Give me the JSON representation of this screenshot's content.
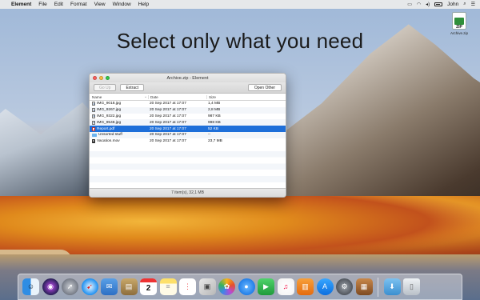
{
  "menubar": {
    "app_name": "Element",
    "items": [
      "File",
      "Edit",
      "Format",
      "View",
      "Window",
      "Help"
    ],
    "user": "John"
  },
  "headline": "Select only what you need",
  "desktop_icon": {
    "label": "ZIP",
    "caption": "Archive.zip"
  },
  "window": {
    "title": "Archive.zip - Element",
    "toolbar": {
      "go_up": "Go Up",
      "extract": "Extract",
      "open_other": "Open Other"
    },
    "columns": {
      "name": "Name",
      "date": "Date",
      "size": "Size"
    },
    "rows": [
      {
        "icon": "image-icon",
        "name": "IMG_9018.jpg",
        "date": "20 Sep 2017 at 17:07",
        "size": "1,4 MB",
        "selected": false
      },
      {
        "icon": "image-icon",
        "name": "IMG_9267.jpg",
        "date": "20 Sep 2017 at 17:07",
        "size": "2,8 MB",
        "selected": false
      },
      {
        "icon": "image-icon",
        "name": "IMG_9322.jpg",
        "date": "20 Sep 2017 at 17:07",
        "size": "987 KB",
        "selected": false
      },
      {
        "icon": "image-icon",
        "name": "IMG_9548.jpg",
        "date": "20 Sep 2017 at 17:07",
        "size": "998 KB",
        "selected": false
      },
      {
        "icon": "pdf-icon",
        "name": "Report.pdf",
        "date": "20 Sep 2017 at 17:07",
        "size": "52 KB",
        "selected": true
      },
      {
        "icon": "folder-icon",
        "name": "Unsorted stuff",
        "date": "20 Sep 2017 at 17:07",
        "size": "--",
        "selected": false
      },
      {
        "icon": "movie-icon",
        "name": "Vacation.mov",
        "date": "20 Sep 2017 at 17:07",
        "size": "23,7 MB",
        "selected": false
      }
    ],
    "status": "7 item(s), 32,1 MB"
  },
  "dock": {
    "calendar_month": "SEP",
    "calendar_day": "2"
  }
}
